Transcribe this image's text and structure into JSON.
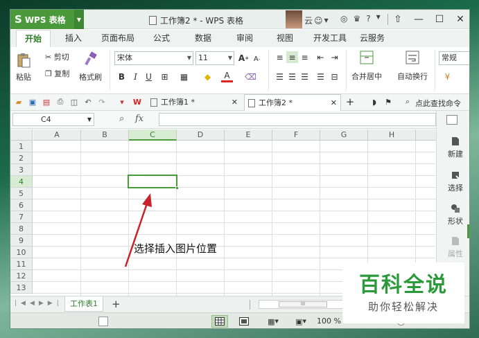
{
  "app": {
    "name": "WPS 表格",
    "logo_glyph": "S",
    "document_title": "工作簿2 * - WPS 表格",
    "user_name": "云",
    "accent_color": "#4a9a3c"
  },
  "title_icons": [
    "skin-icon",
    "shirt-icon",
    "help-icon"
  ],
  "window_controls": {
    "upload": "⇧",
    "minimize": "—",
    "maximize": "☐",
    "close": "✕"
  },
  "menu": {
    "tabs": [
      "开始",
      "插入",
      "页面布局",
      "公式",
      "数据",
      "审阅",
      "视图",
      "开发工具",
      "云服务"
    ],
    "active": "开始"
  },
  "ribbon": {
    "paste": "粘贴",
    "cut": "剪切",
    "copy": "复制",
    "format_painter": "格式刷",
    "font_name": "宋体",
    "font_size": "11",
    "bold": "B",
    "italic": "I",
    "underline": "U",
    "merge_center": "合并居中",
    "wrap_text": "自动换行",
    "number_format": "常规",
    "font_grow": "A",
    "font_shrink": "A",
    "font_color_glyph": "A"
  },
  "quick_access": {
    "doc_tabs": [
      {
        "title": "工作簿1 *",
        "active": false
      },
      {
        "title": "工作簿2 *",
        "active": true
      }
    ],
    "add_tab": "+",
    "search_commands": "点此查找命令"
  },
  "formula_bar": {
    "name_box": "C4",
    "fx_label": "fx",
    "formula_value": ""
  },
  "sheet": {
    "columns": [
      "A",
      "B",
      "C",
      "D",
      "E",
      "F",
      "G",
      "H"
    ],
    "rows": [
      "1",
      "2",
      "3",
      "4",
      "5",
      "6",
      "7",
      "8",
      "9",
      "10",
      "11",
      "12",
      "13"
    ],
    "selected_cell": "C4",
    "annotation": "选择插入图片位置"
  },
  "task_pane": {
    "items": [
      {
        "label": "新建",
        "enabled": true
      },
      {
        "label": "选择",
        "enabled": true
      },
      {
        "label": "形状",
        "enabled": true
      },
      {
        "label": "属性",
        "enabled": false
      }
    ]
  },
  "sheet_tabs": {
    "tabs": [
      "工作表1"
    ],
    "add": "+",
    "scroll_thumb": "III"
  },
  "status_bar": {
    "zoom": "100 %",
    "zoom_minus": "—",
    "zoom_plus": "+"
  },
  "watermark": {
    "title": "百科全说",
    "subtitle": "助你轻松解决"
  }
}
